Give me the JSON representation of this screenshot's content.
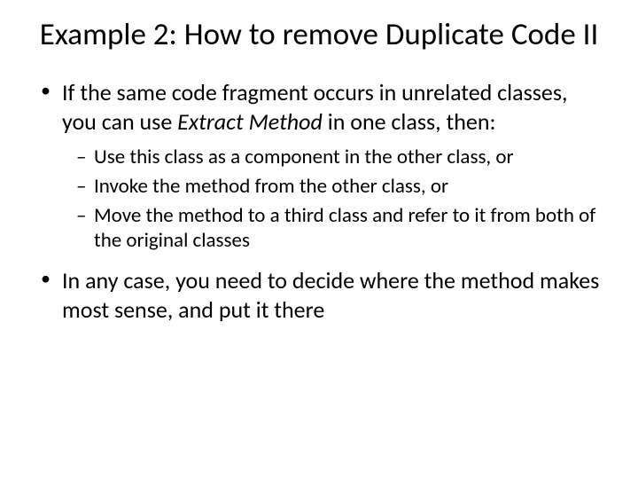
{
  "title": "Example 2: How to remove Duplicate Code II",
  "bullets": [
    {
      "prefix": "If the same code fragment occurs in unrelated classes, you can use ",
      "italic": "Extract Method",
      "suffix": " in one class, then:"
    }
  ],
  "sub_bullets": [
    "Use this class as a component in the other class, or",
    "Invoke the method from the other class, or",
    "Move the method to a third class and refer to it from both of the original classes"
  ],
  "bullet_after": "In any case, you need to decide where the method makes most sense, and put it there"
}
